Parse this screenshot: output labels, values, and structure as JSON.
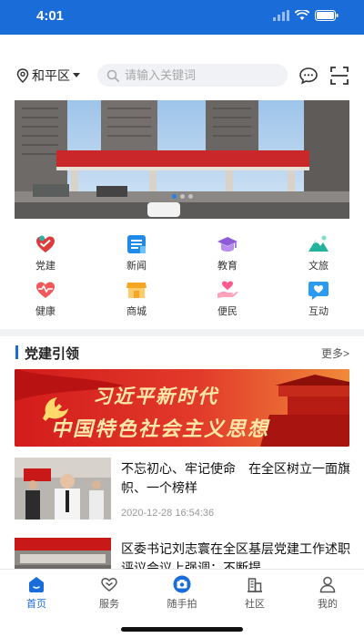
{
  "status_bar": {
    "time": "4:01"
  },
  "header": {
    "location": "和平区",
    "search_placeholder": "请输入关键词"
  },
  "quick_grid": [
    {
      "label": "党建",
      "icon": "party-heart-icon"
    },
    {
      "label": "新闻",
      "icon": "news-icon"
    },
    {
      "label": "教育",
      "icon": "graduation-cap-icon"
    },
    {
      "label": "文旅",
      "icon": "mountain-icon"
    },
    {
      "label": "健康",
      "icon": "heart-pulse-icon"
    },
    {
      "label": "商城",
      "icon": "shop-icon"
    },
    {
      "label": "便民",
      "icon": "helping-hand-icon"
    },
    {
      "label": "互动",
      "icon": "chat-heart-icon"
    }
  ],
  "section": {
    "title": "党建引领",
    "more": "更多>"
  },
  "feature_banner": {
    "line1": "习近平新时代",
    "line2": "中国特色社会主义思想"
  },
  "news": [
    {
      "title": "不忘初心、牢记使命　在全区树立一面旗帜、一个榜样",
      "date": "2020-12-28 16:54:36"
    },
    {
      "title": "区委书记刘志寰在全区基层党建工作述职评议会议上强调：不断提...",
      "date": ""
    }
  ],
  "tab_bar": [
    {
      "label": "首页",
      "icon": "home-icon",
      "active": true
    },
    {
      "label": "服务",
      "icon": "service-heart-icon",
      "active": false
    },
    {
      "label": "随手拍",
      "icon": "camera-icon",
      "active": false
    },
    {
      "label": "社区",
      "icon": "community-building-icon",
      "active": false
    },
    {
      "label": "我的",
      "icon": "user-icon",
      "active": false
    }
  ],
  "colors": {
    "primary": "#1a6cd8",
    "party_red": "#c81818",
    "banner_gold": "#ffe7a8"
  }
}
